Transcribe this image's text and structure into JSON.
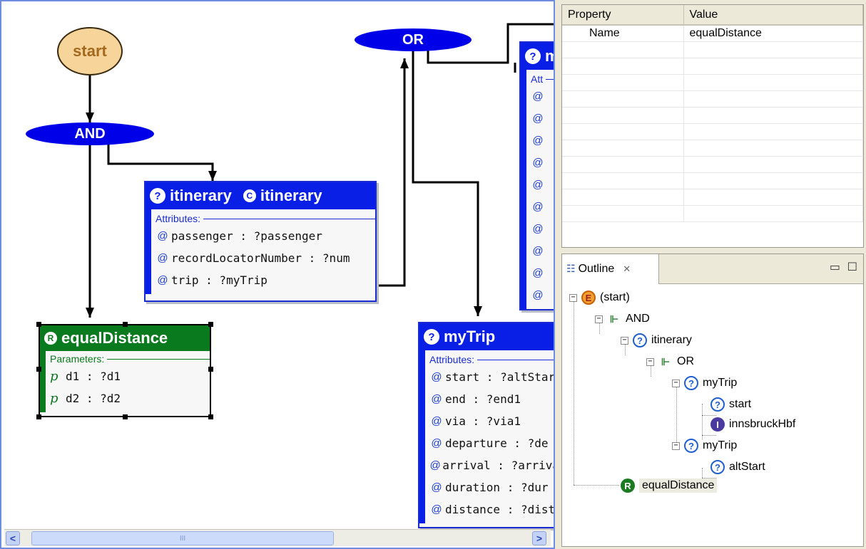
{
  "diagram": {
    "start_label": "start",
    "and_label": "AND",
    "or_label": "OR",
    "itinerary_box": {
      "title1": "itinerary",
      "title2": "itinerary",
      "section": "Attributes:",
      "attrs": [
        "passenger : ?passenger",
        "recordLocatorNumber : ?num",
        "trip : ?myTrip"
      ]
    },
    "equal_box": {
      "title": "equalDistance",
      "section": "Parameters:",
      "params": [
        "d1 : ?d1",
        "d2 : ?d2"
      ]
    },
    "mytrip_box": {
      "title": "myTrip",
      "section": "Attributes:",
      "attrs": [
        "start : ?altStar",
        "end : ?end1",
        "via : ?via1",
        "departure : ?de",
        "arrival : ?arriva",
        "duration : ?dur",
        "distance : ?dist"
      ]
    },
    "partial_box": {
      "title": "m",
      "section": "Att"
    }
  },
  "scrollbar": {
    "left_arrow": "<",
    "right_arrow": ">",
    "thumb_grip": "III"
  },
  "properties": {
    "headers": [
      "Property",
      "Value"
    ],
    "rows": [
      {
        "property": "Name",
        "value": "equalDistance"
      }
    ]
  },
  "outline": {
    "tab_label": "Outline",
    "close_symbol": "✕",
    "nodes": {
      "start": "(start)",
      "and": "AND",
      "itinerary": "itinerary",
      "or": "OR",
      "mytrip1": "myTrip",
      "start_attr": "start",
      "innsbruck": "innsbruckHbf",
      "mytrip2": "myTrip",
      "altstart": "altStart",
      "equal": "equalDistance"
    }
  }
}
